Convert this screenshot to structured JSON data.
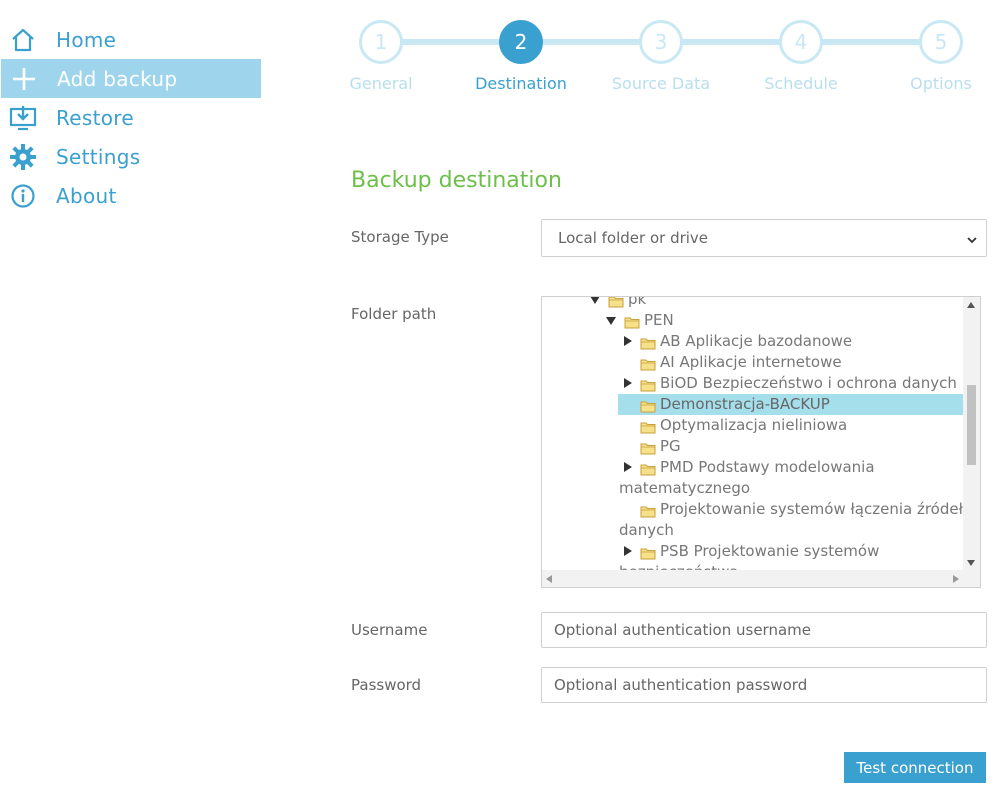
{
  "sidebar": {
    "items": [
      {
        "label": "Home",
        "icon": "home-icon"
      },
      {
        "label": "Add backup",
        "icon": "plus-icon"
      },
      {
        "label": "Restore",
        "icon": "restore-icon"
      },
      {
        "label": "Settings",
        "icon": "gear-icon"
      },
      {
        "label": "About",
        "icon": "info-icon"
      }
    ],
    "active_index": 1
  },
  "stepper": {
    "steps": [
      {
        "number": "1",
        "label": "General"
      },
      {
        "number": "2",
        "label": "Destination"
      },
      {
        "number": "3",
        "label": "Source Data"
      },
      {
        "number": "4",
        "label": "Schedule"
      },
      {
        "number": "5",
        "label": "Options"
      }
    ],
    "active_index": 1
  },
  "form": {
    "title": "Backup destination",
    "storage_type_label": "Storage Type",
    "storage_type_value": "Local folder or drive",
    "folder_path_label": "Folder path",
    "username_label": "Username",
    "username_placeholder": "Optional authentication username",
    "password_label": "Password",
    "password_placeholder": "Optional authentication password",
    "test_button": "Test connection"
  },
  "tree": {
    "rows": [
      {
        "label": "pk",
        "toggle": "open"
      },
      {
        "label": "PEN",
        "toggle": "open"
      },
      {
        "label": "AB Aplikacje bazodanowe",
        "toggle": "closed"
      },
      {
        "label": "AI Aplikacje internetowe",
        "toggle": "none"
      },
      {
        "label": "BiOD Bezpieczeństwo i ochrona danych",
        "toggle": "closed"
      },
      {
        "label": "Demonstracja-BACKUP",
        "toggle": "none",
        "selected": true
      },
      {
        "label": "Optymalizacja nieliniowa",
        "toggle": "none"
      },
      {
        "label": "PG",
        "toggle": "none"
      },
      {
        "label": "PMD Podstawy modelowania",
        "continuation": "matematycznego",
        "toggle": "closed"
      },
      {
        "label": "Projektowanie systemów łączenia źródeł",
        "continuation": "danych",
        "toggle": "none"
      },
      {
        "label": "PSB Projektowanie systemów",
        "continuation": "bezpieczeństwa",
        "toggle": "closed"
      }
    ]
  },
  "colors": {
    "accent": "#3aa0cf",
    "active_nav_bg": "#9ed4ec",
    "title_green": "#6cc04a",
    "selected_row": "#a6dfec"
  }
}
